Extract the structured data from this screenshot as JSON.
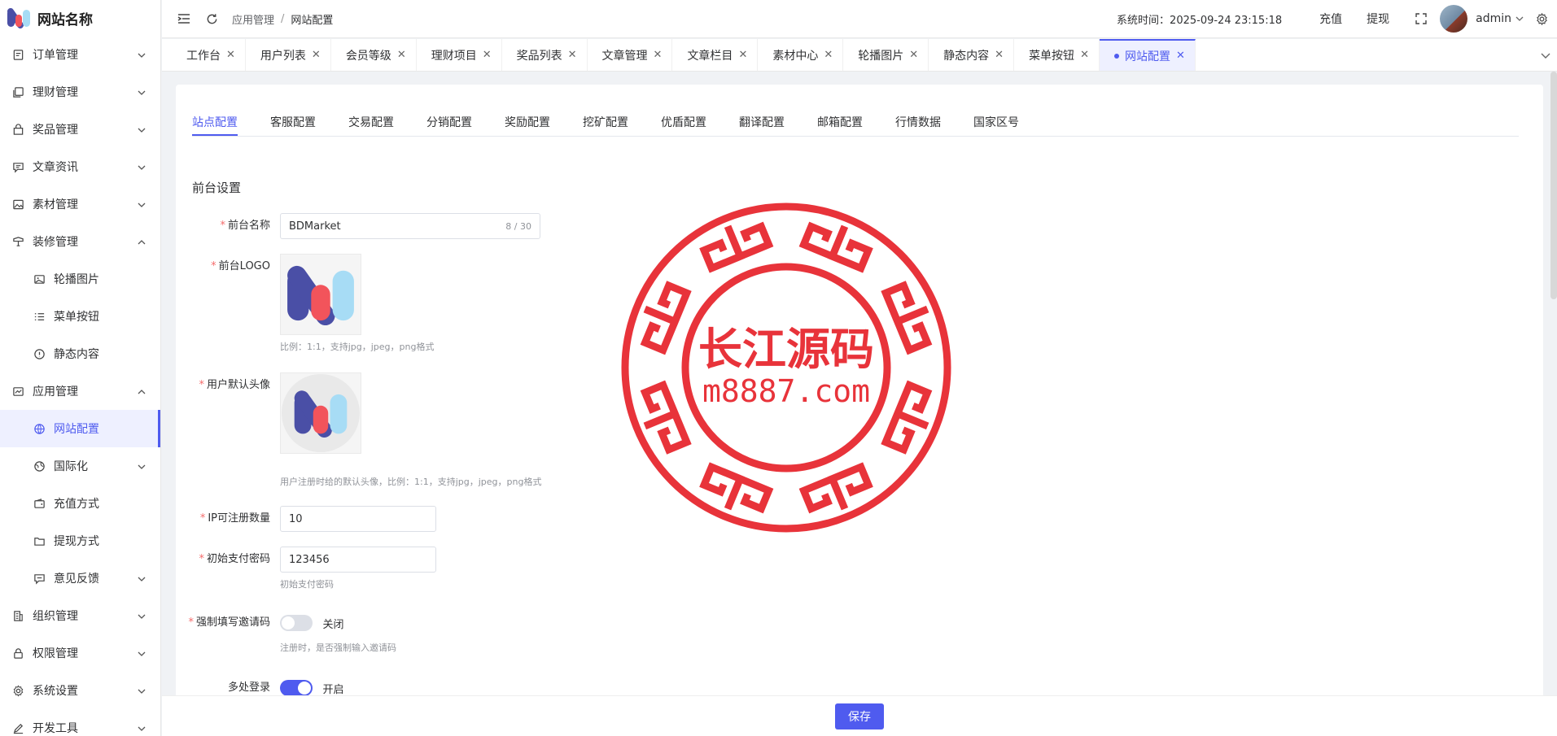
{
  "app": {
    "name": "网站名称"
  },
  "sidebar": {
    "items": [
      {
        "label": "订单管理",
        "icon": "order-icon",
        "expandable": true,
        "expanded": false
      },
      {
        "label": "理财管理",
        "icon": "finance-icon",
        "expandable": true,
        "expanded": false
      },
      {
        "label": "奖品管理",
        "icon": "gift-icon",
        "expandable": true,
        "expanded": false
      },
      {
        "label": "文章资讯",
        "icon": "article-icon",
        "expandable": true,
        "expanded": false
      },
      {
        "label": "素材管理",
        "icon": "image-icon",
        "expandable": true,
        "expanded": false
      },
      {
        "label": "装修管理",
        "icon": "decorate-icon",
        "expandable": true,
        "expanded": true
      },
      {
        "label": "轮播图片",
        "icon": "carousel-icon",
        "sub": true
      },
      {
        "label": "菜单按钮",
        "icon": "list-icon",
        "sub": true
      },
      {
        "label": "静态内容",
        "icon": "info-icon",
        "sub": true
      },
      {
        "label": "应用管理",
        "icon": "app-icon",
        "expandable": true,
        "expanded": true
      },
      {
        "label": "网站配置",
        "icon": "globe-icon",
        "sub": true,
        "active": true
      },
      {
        "label": "国际化",
        "icon": "language-icon",
        "sub": true,
        "expandable": true,
        "expanded": false
      },
      {
        "label": "充值方式",
        "icon": "wallet-icon",
        "sub": true
      },
      {
        "label": "提现方式",
        "icon": "folder-icon",
        "sub": true
      },
      {
        "label": "意见反馈",
        "icon": "feedback-icon",
        "sub": true,
        "expandable": true,
        "expanded": false
      },
      {
        "label": "组织管理",
        "icon": "building-icon",
        "expandable": true,
        "expanded": false
      },
      {
        "label": "权限管理",
        "icon": "lock-icon",
        "expandable": true,
        "expanded": false
      },
      {
        "label": "系统设置",
        "icon": "gear-icon",
        "expandable": true,
        "expanded": false
      },
      {
        "label": "开发工具",
        "icon": "pen-icon",
        "expandable": true,
        "expanded": false
      }
    ]
  },
  "topbar": {
    "breadcrumb": [
      "应用管理",
      "网站配置"
    ],
    "system_time": "系统时间：2025-09-24 23:15:18",
    "recharge": "充值",
    "withdraw": "提现",
    "user": "admin"
  },
  "tabs": [
    {
      "label": "工作台"
    },
    {
      "label": "用户列表"
    },
    {
      "label": "会员等级"
    },
    {
      "label": "理财项目"
    },
    {
      "label": "奖品列表"
    },
    {
      "label": "文章管理"
    },
    {
      "label": "文章栏目"
    },
    {
      "label": "素材中心"
    },
    {
      "label": "轮播图片"
    },
    {
      "label": "静态内容"
    },
    {
      "label": "菜单按钮"
    },
    {
      "label": "网站配置",
      "active": true
    }
  ],
  "subtabs": [
    "站点配置",
    "客服配置",
    "交易配置",
    "分销配置",
    "奖励配置",
    "挖矿配置",
    "优盾配置",
    "翻译配置",
    "邮箱配置",
    "行情数据",
    "国家区号"
  ],
  "form": {
    "section_title": "前台设置",
    "site_name": {
      "label": "前台名称",
      "value": "BDMarket",
      "counter": "8 / 30"
    },
    "logo": {
      "label": "前台LOGO",
      "hint": "比例：1:1，支持jpg，jpeg，png格式"
    },
    "avatar": {
      "label": "用户默认头像",
      "hint": "用户注册时给的默认头像，比例：1:1，支持jpg，jpeg，png格式"
    },
    "ip_limit": {
      "label": "IP可注册数量",
      "value": "10"
    },
    "pay_password": {
      "label": "初始支付密码",
      "value": "123456",
      "hint": "初始支付密码"
    },
    "invite_code": {
      "label": "强制填写邀请码",
      "state": "关闭",
      "on": false,
      "hint": "注册时，是否强制输入邀请码"
    },
    "multi_login": {
      "label": "多处登录",
      "state": "开启",
      "on": true
    }
  },
  "footer": {
    "save": "保存"
  },
  "watermark": {
    "title": "长江源码",
    "url": "m8887.com"
  },
  "colors": {
    "accent": "#4f5bef",
    "required": "#f56c6c",
    "watermark": "#e8333a"
  }
}
